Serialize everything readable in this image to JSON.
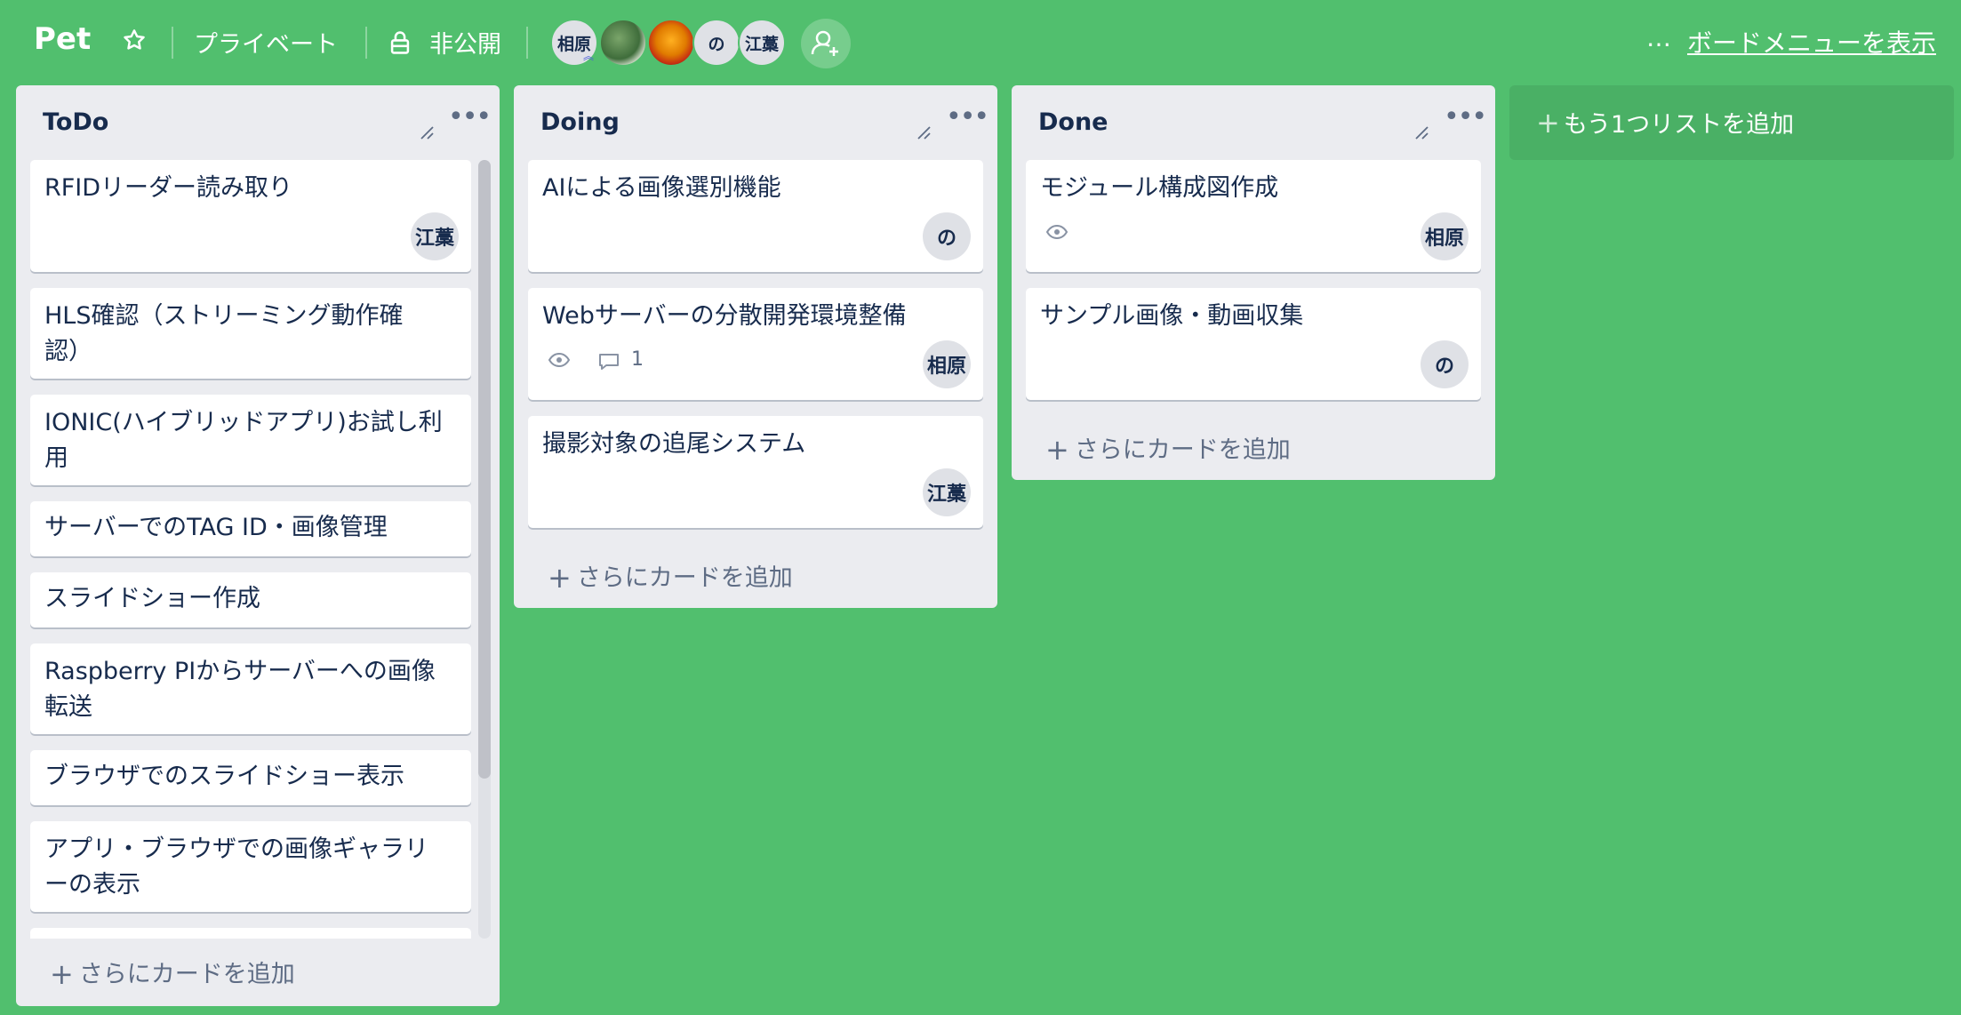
{
  "header": {
    "board_title": "Pet",
    "team_label": "プライベート",
    "visibility_label": "非公開",
    "members": [
      "相原",
      "の",
      "江藁"
    ],
    "more_label": "…",
    "show_menu_label": "ボードメニューを表示"
  },
  "lists": [
    {
      "name": "ToDo",
      "cards": [
        {
          "title": "RFIDリーダー読み取り",
          "member": "江藁"
        },
        {
          "title_lines": [
            "HLS確認（ストリーミング動作確",
            "認）"
          ]
        },
        {
          "title_lines": [
            "IONIC(ハイブリッドアプリ)お試し利",
            "用"
          ]
        },
        {
          "title": "サーバーでのTAG ID・画像管理"
        },
        {
          "title": "スライドショー作成"
        },
        {
          "title_lines": [
            "Raspberry PIからサーバーへの画像",
            "転送"
          ]
        },
        {
          "title": "ブラウザでのスライドショー表示"
        },
        {
          "title_lines": [
            "アプリ・ブラウザでの画像ギャラリ",
            "ーの表示"
          ]
        }
      ],
      "add_card_label": "さらにカードを追加"
    },
    {
      "name": "Doing",
      "cards": [
        {
          "title": "AIによる画像選別機能",
          "member": "の"
        },
        {
          "title": "Webサーバーの分散開発環境整備",
          "comments": "1",
          "member": "相原"
        },
        {
          "title": "撮影対象の追尾システム",
          "member": "江藁"
        }
      ],
      "add_card_label": "さらにカードを追加"
    },
    {
      "name": "Done",
      "cards": [
        {
          "title": "モジュール構成図作成",
          "member": "相原"
        },
        {
          "title": "サンプル画像・動画収集",
          "member": "の"
        }
      ],
      "add_card_label": "さらにカードを追加"
    }
  ],
  "add_list_label": "もう1つリストを追加",
  "colors": {
    "board_background": "#51bf6e",
    "list_background": "#ebecf0",
    "card_background": "#ffffff",
    "text": "#172b4d"
  }
}
